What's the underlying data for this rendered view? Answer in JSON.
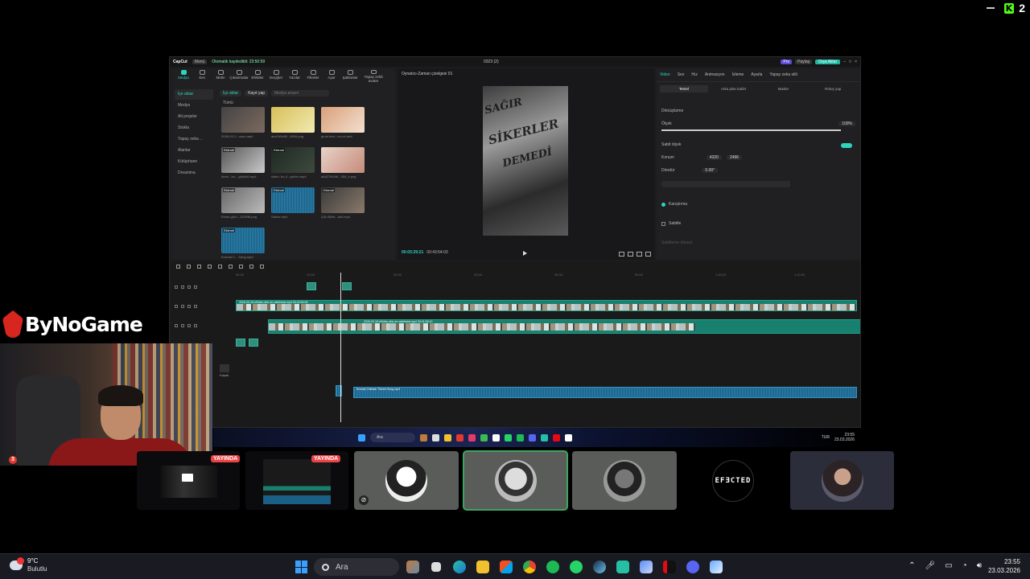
{
  "overlay": {
    "kick_logo": "K",
    "viewer_count": "2",
    "minimize_glyph": "—"
  },
  "capcut": {
    "titlebar": {
      "logo": "CapCut",
      "menu": "Menü",
      "autosave": "Otomatik kaydedildi: 23:50:59",
      "project_title": "0323 (2)",
      "pro": "Pro",
      "share": "Paylaş",
      "export": "Dışa Aktar"
    },
    "toolbar": [
      "Medya",
      "Ses",
      "Metin",
      "Çıkartmalar",
      "Efektler",
      "Geçişler",
      "Yazılar",
      "Filtreler",
      "Ayar",
      "Şablonlar",
      "Yapay zekâ avatar"
    ],
    "sidebar": [
      "İçe aktar",
      "Medya",
      "Alt projeler",
      "Stokla",
      "Yapay zeka ...",
      "Alanlar",
      "Kütüphane",
      "Dreamina"
    ],
    "media_head": {
      "import": "İçe aktar",
      "record": "Kayıt yap",
      "search_placeholder": "Medya arayın"
    },
    "media_tag": "Tümü",
    "media_items": [
      {
        "name": "2026-03-1...uuuu.mp4",
        "tag": ""
      },
      {
        "name": "aba7b0e80...8926.png",
        "tag": ""
      },
      {
        "name": "grunt-text...nm-ni.web",
        "tag": ""
      },
      {
        "name": "tümü - ho... görüldü.mp4",
        "tag": "Eklendi"
      },
      {
        "name": "video- bu-4...görüm.mp4",
        "tag": "Eklendi"
      },
      {
        "name": "a6d27f4446...554_n.png",
        "tag": ""
      },
      {
        "name": "Ekran görü...120938.png",
        "tag": "Eklendi"
      },
      {
        "name": "Sahne.mp4",
        "tag": "Eklendi"
      },
      {
        "name": "ÇALIŞMA...sk0.mp4",
        "tag": "Eklendi"
      },
      {
        "name": "Kromat C... Song.mp3",
        "tag": "Eklendi"
      }
    ],
    "player": {
      "title": "Oynatıcı-Zaman çizelgesi 01",
      "timecode": "00:03:29:21",
      "duration": "00:43:54:03",
      "video_text_1": "SAĞIR",
      "video_text_2": "SİKERLER",
      "video_text_3": "DEMEDİ"
    },
    "props": {
      "tabs": [
        "Video",
        "Ses",
        "Hız",
        "Animasyon",
        "İzleme",
        "Ayarla",
        "Yapay zeka stili"
      ],
      "subtabs": [
        "Temel",
        "Arka plan kaldır",
        "Maske",
        "Rötuş yap"
      ],
      "transform_label": "Dönüştürme",
      "scale_label": "Ölçek",
      "scale_value": "100%",
      "uniform_label": "Sabit ölçek",
      "position_label": "Konum",
      "pos_x": "4320",
      "pos_y": "2496",
      "rotate_label": "Döndür",
      "rotate_value": "0.00°",
      "blend_label": "Karıştırma",
      "stabilize_label": "Sabitle",
      "stabilize_level": "Sabitleme düzeyi"
    },
    "ruler": [
      "00:00",
      "10:00",
      "20:00",
      "30:00",
      "40:00",
      "50:00",
      "1:00:00",
      "1:10:00"
    ],
    "clip_label_1": "2026-03-18-sf3oleu-ahn-en-vakitmesi.mp4   00:43:54:06",
    "clip_label_2": "2026-03-18-sf3oleu-ahn-en-vakitmesi.mp4   00:41:56:10",
    "audio_label": "Kromat Chiesarı Theme Song.mp3",
    "cover_label": "Kapak"
  },
  "inner_taskbar": {
    "search": "Ara",
    "lang": "TUR",
    "time": "23:55",
    "date": "23.03.2026"
  },
  "bynogame": {
    "text": "ByNoGame"
  },
  "webcam": {
    "notification_count": "3"
  },
  "tiles": [
    {
      "live": ""
    },
    {
      "live": "YAYINDA"
    },
    {
      "live": "YAYINDA"
    },
    {
      "live": ""
    },
    {
      "live": ""
    },
    {
      "live": ""
    },
    {
      "live": ""
    },
    {
      "live": ""
    }
  ],
  "tile_text": {
    "efected": "EFƎCTED"
  },
  "taskbar": {
    "temp": "9°C",
    "weather": "Bulutlu",
    "search": "Ara",
    "time": "23:55",
    "date": "23.03.2026"
  },
  "colors": {
    "accent": "#2dd4bf",
    "live": "#ed4245",
    "speaking": "#3ba55d",
    "kick": "#53fc18"
  }
}
